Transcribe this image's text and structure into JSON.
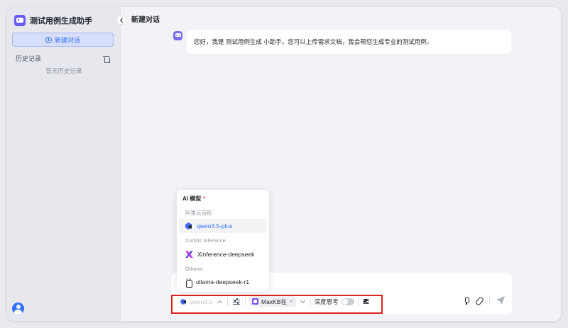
{
  "app": {
    "title": "测试用例生成助手"
  },
  "sidebar": {
    "new_chat_label": "新建对话",
    "history_label": "历史记录",
    "history_empty": "暂无历史记录"
  },
  "chat": {
    "title": "新建对话",
    "messages": [
      {
        "role": "assistant",
        "text": "您好，我是 测试用例生成 小助手，您可以上传需求文档，我会帮您生成专业的测试用例。"
      }
    ]
  },
  "model_dropdown": {
    "header": "AI 模型",
    "required_mark": "*",
    "groups": [
      {
        "name": "阿里云百炼",
        "models": [
          {
            "name": "qwen3.5-plus",
            "icon": "qwen-icon",
            "selected": true
          }
        ]
      },
      {
        "name": "Xorbits Inference",
        "models": [
          {
            "name": "Xinference-deepseek",
            "icon": "xinference-icon",
            "selected": false
          }
        ]
      },
      {
        "name": "Ollama",
        "models": [
          {
            "name": "ollama-deepseek-r1",
            "icon": "ollama-icon",
            "selected": false
          }
        ]
      }
    ]
  },
  "toolbar": {
    "model_value": "qwen3.5-",
    "knowledge_base": "MaxKB在",
    "kb_close": "×",
    "deep_think_label": "深度思考",
    "deep_think_on": false
  },
  "colors": {
    "accent": "#3370ff",
    "highlight_border": "#e02020",
    "brand": "#6b5cf6"
  }
}
